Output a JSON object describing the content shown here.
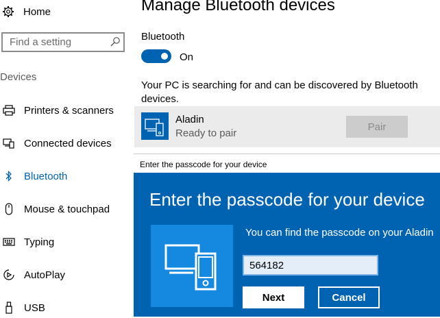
{
  "sidebar": {
    "home_label": "Home",
    "search_placeholder": "Find a setting",
    "section_label": "Devices",
    "items": [
      {
        "label": "Printers & scanners",
        "icon": "printer-icon"
      },
      {
        "label": "Connected devices",
        "icon": "connected-devices-icon"
      },
      {
        "label": "Bluetooth",
        "icon": "bluetooth-icon",
        "active": true
      },
      {
        "label": "Mouse & touchpad",
        "icon": "mouse-icon"
      },
      {
        "label": "Typing",
        "icon": "keyboard-icon"
      },
      {
        "label": "AutoPlay",
        "icon": "autoplay-icon"
      },
      {
        "label": "USB",
        "icon": "usb-icon"
      }
    ]
  },
  "main": {
    "title": "Manage Bluetooth devices",
    "bluetooth_label": "Bluetooth",
    "toggle_state": "On",
    "description": "Your PC is searching for and can be discovered by Bluetooth devices.",
    "device": {
      "name": "Aladin",
      "status": "Ready to pair",
      "pair_label": "Pair"
    }
  },
  "dialog": {
    "titlebar": "Enter the passcode for your device",
    "heading": "Enter the passcode for your device",
    "message": "You can find the passcode on your Aladin",
    "passcode": "564182",
    "next_label": "Next",
    "cancel_label": "Cancel"
  },
  "colors": {
    "accent": "#0063b1",
    "dialog_icon_bg": "#1588e0",
    "row_bg": "#ebebeb"
  }
}
